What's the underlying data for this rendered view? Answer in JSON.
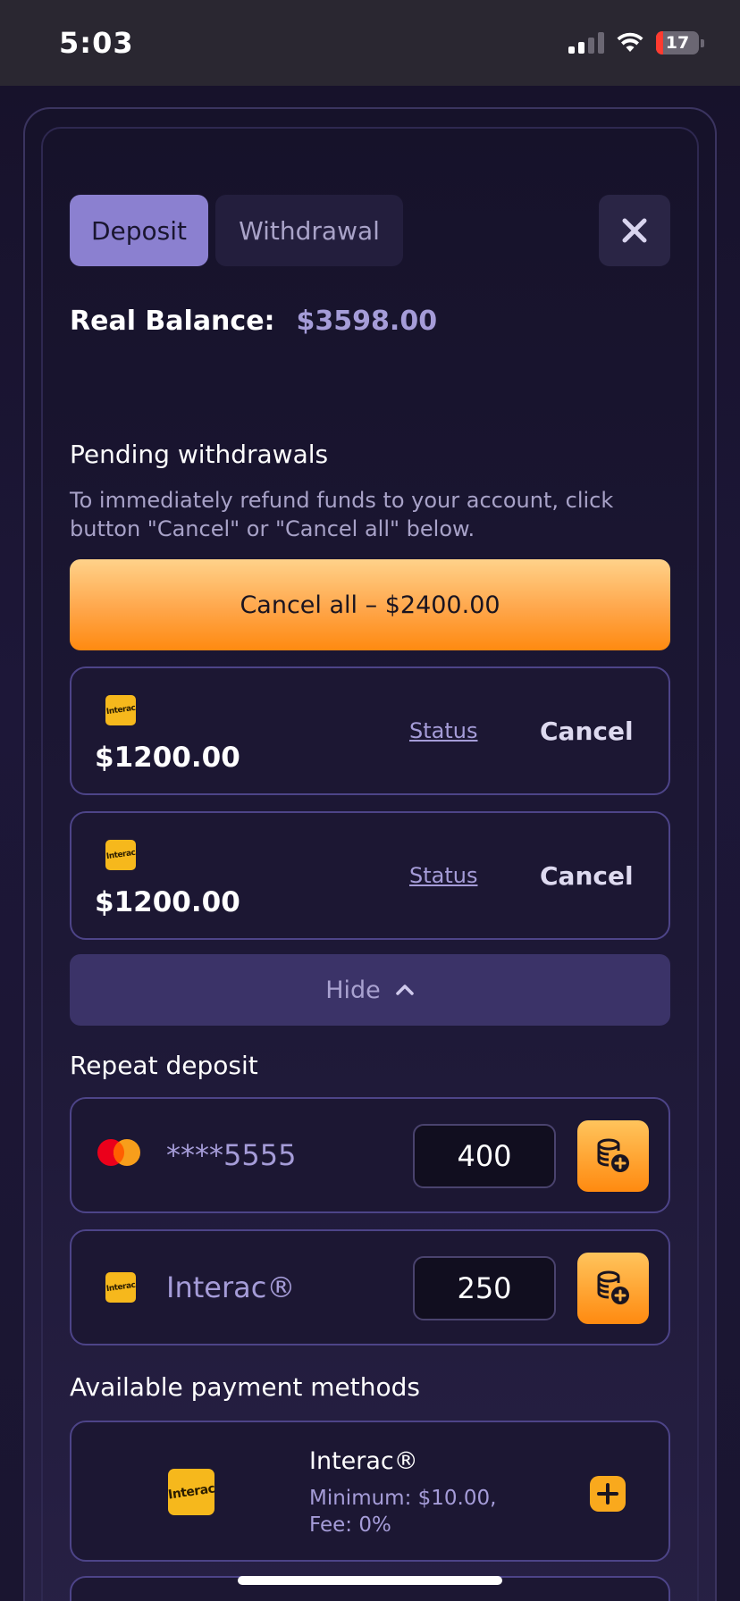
{
  "status_bar": {
    "time": "5:03",
    "battery": "17",
    "battery_level": 0.17
  },
  "tabs": [
    {
      "label": "Deposit",
      "active": true
    },
    {
      "label": "Withdrawal",
      "active": false
    }
  ],
  "balance": {
    "label": "Real Balance:",
    "value": "$3598.00"
  },
  "pending": {
    "title": "Pending withdrawals",
    "description": "To immediately refund funds to your account, click button \"Cancel\" or \"Cancel all\" below.",
    "cancel_all_label": "Cancel all – $2400.00",
    "items": [
      {
        "logo_text": "Interac",
        "amount": "$1200.00",
        "status_label": "Status",
        "cancel_label": "Cancel"
      },
      {
        "logo_text": "Interac",
        "amount": "$1200.00",
        "status_label": "Status",
        "cancel_label": "Cancel"
      }
    ],
    "hide_label": "Hide"
  },
  "repeat": {
    "title": "Repeat deposit",
    "items": [
      {
        "label": "****5555",
        "amount": "400",
        "method": "mastercard"
      },
      {
        "label": "Interac®",
        "amount": "250",
        "method": "interac",
        "logo_text": "Interac"
      }
    ]
  },
  "available": {
    "title": "Available payment methods",
    "items": [
      {
        "name": "Interac®",
        "logo_text": "Interac",
        "minimum": "Minimum: $10.00,",
        "fee": "Fee: 0%"
      }
    ]
  },
  "colors": {
    "accent": "#8b80d0",
    "orange": "#ff8a10",
    "card_border": "#4d4488"
  }
}
